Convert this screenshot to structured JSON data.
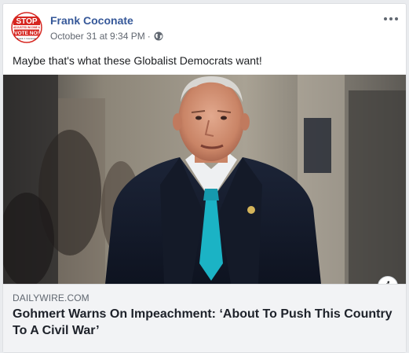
{
  "post": {
    "author": "Frank Coconate",
    "timestamp": "October 31 at 9:34 PM",
    "separator": "·",
    "privacy_icon": "globe-icon",
    "text": "Maybe that's what these Globalist Democrats want!",
    "avatar": {
      "line1": "STOP",
      "line2": "ADJUSTED INCOME &",
      "line3": "VOTE NO!",
      "line4": "Frank J. Coconate"
    }
  },
  "link": {
    "domain": "DAILYWIRE.COM",
    "title": "Gohmert Warns On Impeachment: ‘About To Push This Country To A Civil War’",
    "info_icon": "i"
  },
  "colors": {
    "author_link": "#365899",
    "avatar_red": "#d6251f",
    "card_background": "#f2f3f5"
  }
}
